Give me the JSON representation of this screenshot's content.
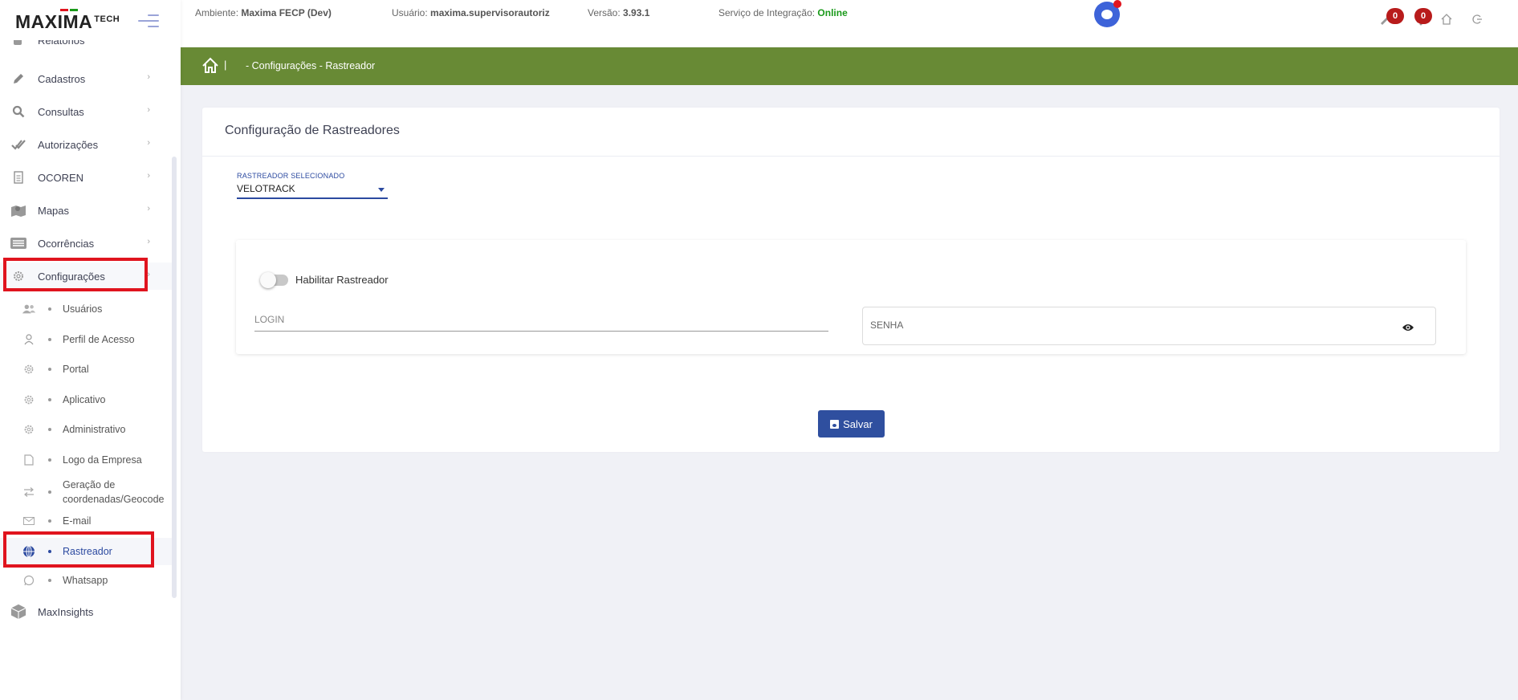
{
  "brand": {
    "logo_text": "MAXIMA",
    "logo_suffix": "TECH"
  },
  "header": {
    "ambiente_label": "Ambiente:",
    "ambiente_value": "Maxima FECP (Dev)",
    "usuario_label": "Usuário:",
    "usuario_value": "maxima.supervisorautoriz",
    "versao_label": "Versão:",
    "versao_value": "3.93.1",
    "servico_label": "Serviço de Integração:",
    "servico_value": "Online",
    "badge_1": "0",
    "badge_2": "0"
  },
  "sidebar": {
    "partial_top": "Relatórios",
    "items": [
      {
        "label": "Cadastros",
        "icon": "pencil-icon"
      },
      {
        "label": "Consultas",
        "icon": "search-icon"
      },
      {
        "label": "Autorizações",
        "icon": "double-check-icon"
      },
      {
        "label": "OCOREN",
        "icon": "document-icon"
      },
      {
        "label": "Mapas",
        "icon": "map-icon"
      },
      {
        "label": "Ocorrências",
        "icon": "list-icon"
      },
      {
        "label": "Configurações",
        "icon": "gear-icon"
      }
    ],
    "subitems": [
      {
        "label": "Usuários",
        "icon": "users-icon"
      },
      {
        "label": "Perfil de Acesso",
        "icon": "user-icon"
      },
      {
        "label": "Portal",
        "icon": "gear-icon"
      },
      {
        "label": "Aplicativo",
        "icon": "gear-icon"
      },
      {
        "label": "Administrativo",
        "icon": "gear-icon"
      },
      {
        "label": "Logo da Empresa",
        "icon": "file-icon"
      },
      {
        "label": "Geração de coordenadas/Geocode",
        "icon": "swap-icon"
      },
      {
        "label": "E-mail",
        "icon": "mail-icon"
      },
      {
        "label": "Rastreador",
        "icon": "globe-icon"
      },
      {
        "label": "Whatsapp",
        "icon": "whatsapp-icon"
      }
    ],
    "bottom_item": {
      "label": "MaxInsights",
      "icon": "cube-icon"
    }
  },
  "breadcrumb": {
    "separator": "|",
    "path": "- Configurações - Rastreador"
  },
  "card": {
    "title": "Configuração de Rastreadores",
    "select_label": "RASTREADOR SELECIONADO",
    "select_value": "VELOTRACK",
    "toggle_label": "Habilitar Rastreador",
    "toggle_on": false,
    "login_placeholder": "LOGIN",
    "senha_placeholder": "SENHA",
    "save_label": "Salvar"
  },
  "colors": {
    "accent_green": "#688a35",
    "primary_blue": "#2f4f9f",
    "highlight_red": "#e0141e"
  }
}
